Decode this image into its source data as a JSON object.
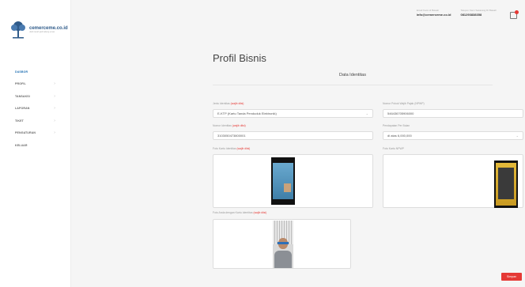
{
  "brand": {
    "name": "cemerceme.co.id",
    "tagline": "ubah tanah jadi ladang emas"
  },
  "sidebar": {
    "items": [
      {
        "label": "DASBOR",
        "active": true,
        "has_children": false
      },
      {
        "label": "PROFIL",
        "active": false,
        "has_children": true
      },
      {
        "label": "TANSAKSI",
        "active": false,
        "has_children": true
      },
      {
        "label": "LAPORAN",
        "active": false,
        "has_children": true
      },
      {
        "label": "TIKET",
        "active": false,
        "has_children": true
      },
      {
        "label": "PENGATURAN",
        "active": false,
        "has_children": true
      },
      {
        "label": "KELUAR",
        "active": false,
        "has_children": false
      }
    ]
  },
  "header": {
    "email_label": "Email Kami di Bawah",
    "email_value": "info@cemerceme.co.id",
    "phone_label": "Telepon Kami Sekarang Di Bawah",
    "phone_value": "081293838358",
    "notification_icon": "bag-icon",
    "notification_dot_color": "#e53935"
  },
  "page": {
    "title": "Profil Bisnis",
    "section": "Data Identitas"
  },
  "form": {
    "jenis_identitas": {
      "label": "Jenis Identitas",
      "required": "(wajib diisi)",
      "value": "E-KTP (Kartu Tanda Penduduk Elektronik)"
    },
    "nomor_identitas": {
      "label": "Nomor Identitas",
      "required": "(wajib diisi)",
      "value": "3103050473800001"
    },
    "foto_kartu_identitas": {
      "label": "Foto Kartu Identitas",
      "required": "(wajib diisi)"
    },
    "npwp": {
      "label": "Nomor Pokok Wajib Pajak (NPWP)",
      "value": "546436705906000"
    },
    "pendapatan": {
      "label": "Pendapatan Per Bulan",
      "value": "di atas 6,000,000"
    },
    "foto_npwp": {
      "label": "Foto Kartu NPWP"
    },
    "foto_selfie": {
      "label": "Foto Anda dengan Kartu Identitas",
      "required": "(wajib diisi)"
    }
  },
  "actions": {
    "save_label": "Simpan",
    "accent": "#e53935"
  }
}
